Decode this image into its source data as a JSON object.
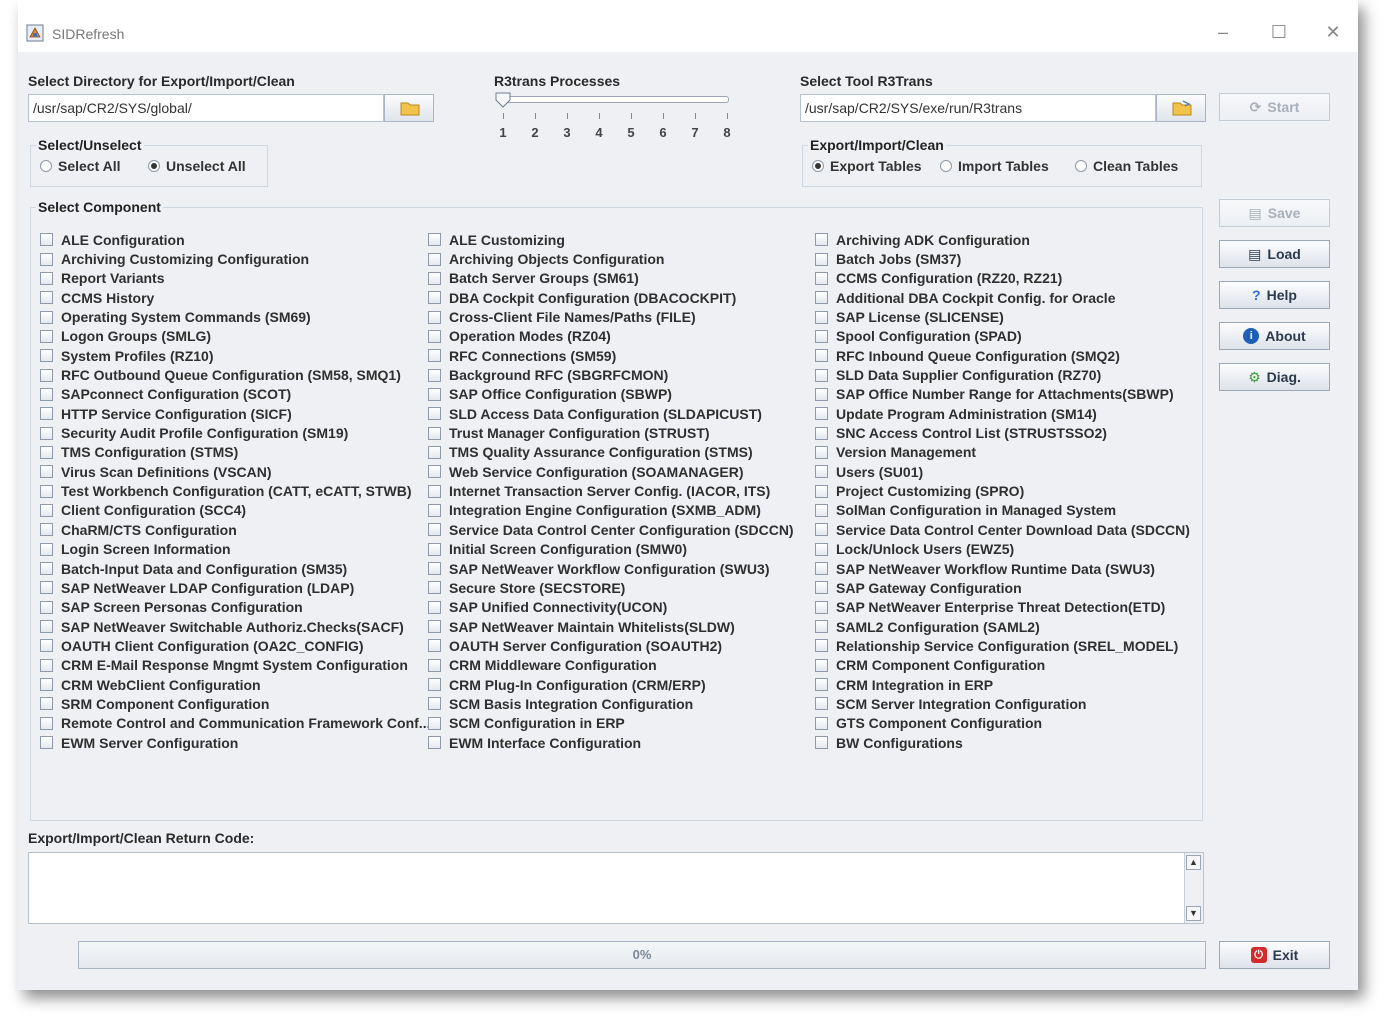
{
  "window": {
    "title": "SIDRefresh"
  },
  "directory": {
    "label": "Select Directory for Export/Import/Clean",
    "value": "/usr/sap/CR2/SYS/global/"
  },
  "r3trans_processes": {
    "label": "R3trans Processes",
    "ticks": [
      "1",
      "2",
      "3",
      "4",
      "5",
      "6",
      "7",
      "8"
    ],
    "selected": 1
  },
  "tool": {
    "label": "Select Tool R3Trans",
    "value": "/usr/sap/CR2/SYS/exe/run/R3trans"
  },
  "select_unselect": {
    "title": "Select/Unselect",
    "select_all": "Select All",
    "unselect_all": "Unselect All",
    "selected": "unselect_all"
  },
  "mode": {
    "title": "Export/Import/Clean",
    "export": "Export Tables",
    "import": "Import Tables",
    "clean": "Clean Tables",
    "selected": "export"
  },
  "buttons": {
    "start": "Start",
    "save": "Save",
    "load": "Load",
    "help": "Help",
    "about": "About",
    "diag": "Diag.",
    "exit": "Exit"
  },
  "component": {
    "title": "Select Component",
    "columns": [
      [
        "ALE Configuration",
        "Archiving Customizing Configuration",
        "Report Variants",
        "CCMS History",
        "Operating System Commands (SM69)",
        "Logon Groups (SMLG)",
        "System Profiles (RZ10)",
        "RFC Outbound Queue Configuration (SM58, SMQ1)",
        "SAPconnect Configuration (SCOT)",
        "HTTP Service Configuration (SICF)",
        "Security Audit Profile Configuration (SM19)",
        "TMS Configuration (STMS)",
        "Virus Scan Definitions (VSCAN)",
        "Test Workbench Configuration (CATT, eCATT, STWB)",
        "Client Configuration (SCC4)",
        "ChaRM/CTS Configuration",
        "Login Screen Information",
        "Batch-Input Data and Configuration (SM35)",
        "SAP NetWeaver LDAP Configuration (LDAP)",
        "SAP Screen Personas Configuration",
        "SAP NetWeaver Switchable Authoriz.Checks(SACF)",
        "OAUTH Client Configuration (OA2C_CONFIG)",
        "CRM E-Mail Response Mngmt System Configuration",
        "CRM WebClient Configuration",
        "SRM Component Configuration",
        "Remote Control and Communication Framework Conf...",
        "EWM Server Configuration"
      ],
      [
        "ALE Customizing",
        "Archiving Objects Configuration",
        "Batch Server Groups (SM61)",
        "DBA Cockpit Configuration (DBACOCKPIT)",
        "Cross-Client File Names/Paths (FILE)",
        "Operation Modes (RZ04)",
        "RFC Connections (SM59)",
        "Background RFC (SBGRFCMON)",
        "SAP Office Configuration (SBWP)",
        "SLD Access Data Configuration (SLDAPICUST)",
        "Trust Manager Configuration (STRUST)",
        "TMS Quality Assurance Configuration (STMS)",
        "Web Service Configuration (SOAMANAGER)",
        "Internet Transaction Server Config. (IACOR, ITS)",
        "Integration Engine Configuration (SXMB_ADM)",
        "Service Data Control Center Configuration (SDCCN)",
        "Initial Screen Configuration (SMW0)",
        "SAP NetWeaver Workflow Configuration (SWU3)",
        "Secure Store (SECSTORE)",
        "SAP Unified Connectivity(UCON)",
        "SAP NetWeaver Maintain Whitelists(SLDW)",
        "OAUTH Server Configuration (SOAUTH2)",
        "CRM Middleware Configuration",
        "CRM Plug-In Configuration (CRM/ERP)",
        "SCM Basis Integration Configuration",
        "SCM Configuration in ERP",
        "EWM Interface Configuration"
      ],
      [
        "Archiving ADK Configuration",
        "Batch Jobs (SM37)",
        "CCMS Configuration (RZ20, RZ21)",
        "Additional DBA Cockpit Config. for Oracle",
        "SAP License (SLICENSE)",
        "Spool Configuration (SPAD)",
        "RFC Inbound Queue Configuration (SMQ2)",
        "SLD Data Supplier Configuration (RZ70)",
        "SAP Office Number Range for Attachments(SBWP)",
        "Update Program Administration (SM14)",
        "SNC Access Control List (STRUSTSSO2)",
        "Version Management",
        "Users (SU01)",
        "Project Customizing (SPRO)",
        "SolMan Configuration in Managed System",
        "Service Data Control Center Download Data (SDCCN)",
        "Lock/Unlock Users (EWZ5)",
        "SAP NetWeaver Workflow Runtime Data (SWU3)",
        "SAP Gateway Configuration",
        "SAP NetWeaver Enterprise Threat Detection(ETD)",
        "SAML2 Configuration (SAML2)",
        "Relationship Service Configuration (SREL_MODEL)",
        "CRM Component Configuration",
        "CRM Integration in ERP",
        "SCM Server Integration Configuration",
        "GTS Component Configuration",
        "BW Configurations"
      ]
    ]
  },
  "return_code": {
    "label": "Export/Import/Clean Return Code:",
    "value": ""
  },
  "progress": {
    "text": "0%",
    "value": 0
  }
}
